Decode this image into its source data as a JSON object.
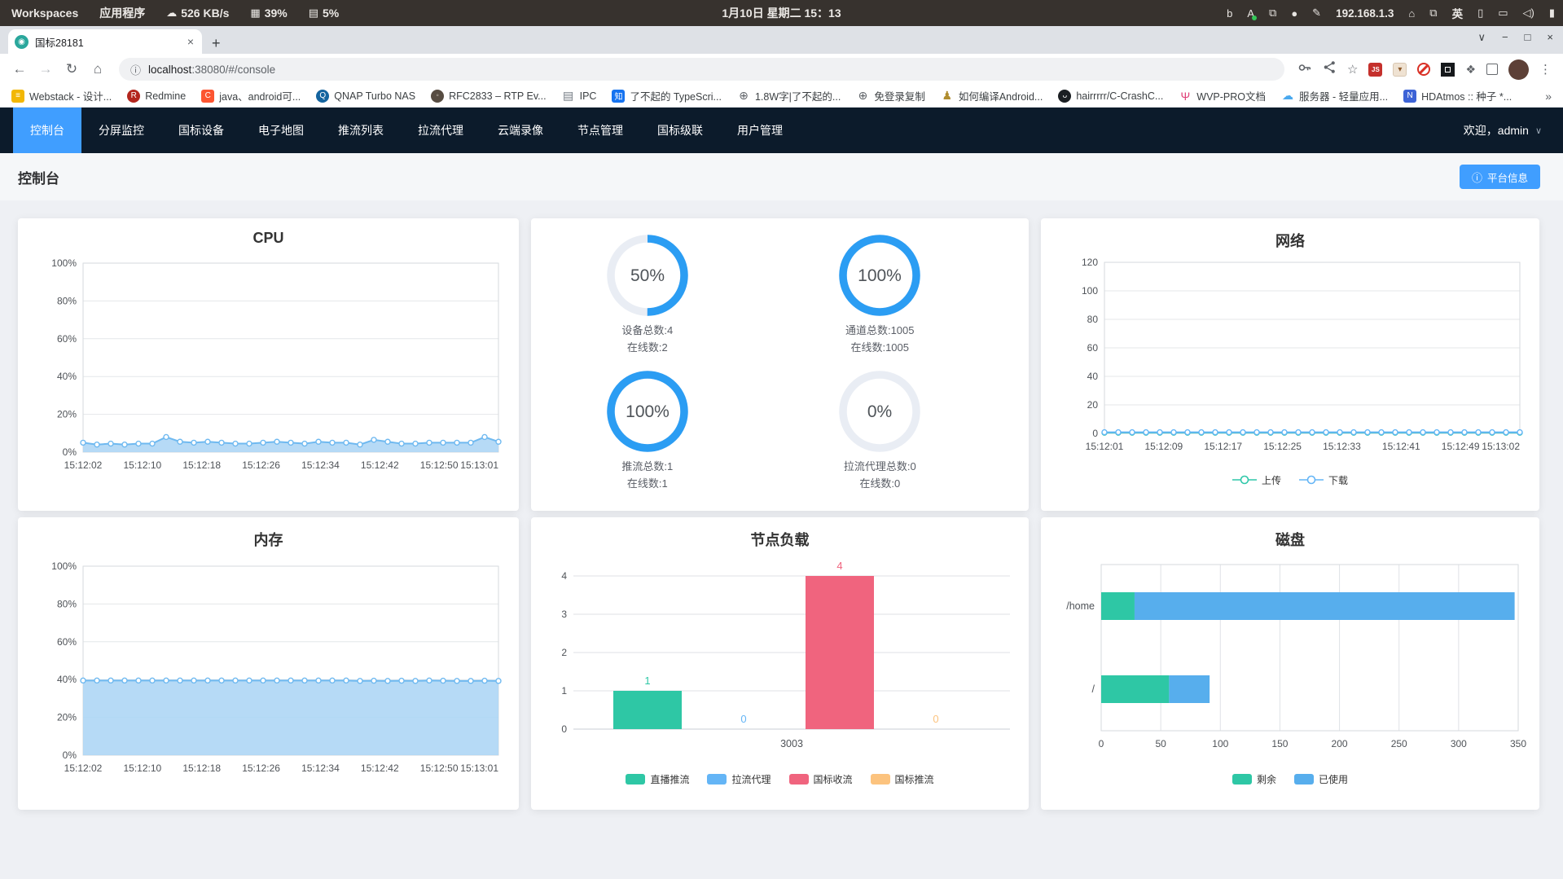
{
  "system_bar": {
    "workspaces": "Workspaces",
    "applications": "应用程序",
    "network_speed": "526 KB/s",
    "cpu_percent": "39%",
    "mem_percent": "5%",
    "datetime": "1月10日 星期二  15：13",
    "tray": [
      {
        "name": "bing-icon",
        "glyph": "b"
      },
      {
        "name": "text-tool-icon",
        "glyph": "A",
        "cls": "atool"
      },
      {
        "name": "clipboard-icon",
        "glyph": "⧉"
      },
      {
        "name": "app-circle-icon",
        "glyph": "●"
      },
      {
        "name": "screenshot-tool-icon",
        "glyph": "✎"
      },
      {
        "name": "ip-address",
        "text": "192.168.1.3"
      },
      {
        "name": "home-icon",
        "glyph": "⌂"
      },
      {
        "name": "windows-overlap-icon",
        "glyph": "⧉"
      },
      {
        "name": "input-method-indicator",
        "text": "英"
      },
      {
        "name": "tablet-icon",
        "glyph": "▯"
      },
      {
        "name": "display-icon",
        "glyph": "▭"
      },
      {
        "name": "volume-icon",
        "glyph": "◁)"
      },
      {
        "name": "battery-icon",
        "glyph": "▮"
      }
    ]
  },
  "browser": {
    "tab_title": "国标28181",
    "url_host": "localhost",
    "url_rest": ":38080/#/console",
    "bookmarks": [
      {
        "label": "Webstack - 设计...",
        "shape": "square",
        "bg": "#f2b705",
        "fg": "#ffffff",
        "glyph": "≡"
      },
      {
        "label": "Redmine",
        "shape": "circle",
        "bg": "#b3261e",
        "fg": "#ffffff",
        "glyph": "R"
      },
      {
        "label": "java、android可...",
        "shape": "square",
        "bg": "#fc5531",
        "fg": "#ffffff",
        "glyph": "C"
      },
      {
        "label": "QNAP Turbo NAS",
        "shape": "circle",
        "bg": "#14649f",
        "fg": "#ffffff",
        "glyph": "Q"
      },
      {
        "label": "RFC2833 – RTP Ev...",
        "shape": "circle",
        "bg": "#574c42",
        "fg": "#cfc8bd",
        "glyph": "◦"
      },
      {
        "label": "IPC",
        "shape": "plain",
        "bg": "",
        "fg": "#707880",
        "glyph": "▤"
      },
      {
        "label": "了不起的 TypeScri...",
        "shape": "square",
        "bg": "#1673f0",
        "fg": "#ffffff",
        "glyph": "知"
      },
      {
        "label": "1.8W字|了不起的...",
        "shape": "plain",
        "bg": "",
        "fg": "#5f6368",
        "glyph": "⊕"
      },
      {
        "label": "免登录复制",
        "shape": "plain",
        "bg": "",
        "fg": "#5f6368",
        "glyph": "⊕"
      },
      {
        "label": "如何编译Android...",
        "shape": "plain",
        "bg": "",
        "fg": "#b08d2f",
        "glyph": "♟"
      },
      {
        "label": "hairrrrr/C-CrashC...",
        "shape": "circle",
        "bg": "#1b1f23",
        "fg": "#ffffff",
        "glyph": "ᴗ"
      },
      {
        "label": "WVP-PRO文档",
        "shape": "plain",
        "bg": "",
        "fg": "#e0447a",
        "glyph": "Ψ"
      },
      {
        "label": "服务器 - 轻量应用...",
        "shape": "plain",
        "bg": "",
        "fg": "#49a8ee",
        "glyph": "☁"
      },
      {
        "label": "HDAtmos :: 种子 *...",
        "shape": "square",
        "bg": "#3d63d6",
        "fg": "#ffffff",
        "glyph": "N"
      }
    ],
    "overflow": "»"
  },
  "icons": {
    "back": "←",
    "forward": "→",
    "reload": "↻",
    "home": "⌂",
    "star": "☆",
    "menu": "⋮",
    "new_tab": "+",
    "tab_close": "×",
    "chevron": "∨",
    "minimize": "−",
    "maximize": "□",
    "close": "×",
    "info": "ⓘ",
    "puzzle": "❖",
    "js_badge": "JS"
  },
  "app": {
    "nav": {
      "items": [
        "控制台",
        "分屏监控",
        "国标设备",
        "电子地图",
        "推流列表",
        "拉流代理",
        "云端录像",
        "节点管理",
        "国标级联",
        "用户管理"
      ],
      "active_index": 0,
      "welcome": "欢迎，admin"
    },
    "page_title": "控制台",
    "platform_info_button": "平台信息",
    "gauges": [
      {
        "percent": "50%",
        "value": 50,
        "line1": "设备总数:4",
        "line2": "在线数:2"
      },
      {
        "percent": "100%",
        "value": 100,
        "line1": "通道总数:1005",
        "line2": "在线数:1005"
      },
      {
        "percent": "100%",
        "value": 100,
        "line1": "推流总数:1",
        "line2": "在线数:1"
      },
      {
        "percent": "0%",
        "value": 0,
        "line1": "拉流代理总数:0",
        "line2": "在线数:0"
      }
    ],
    "gauge_color": "#2b9df3",
    "gauge_track": "#e9edf4"
  },
  "chart_data": [
    {
      "id": "cpu",
      "type": "area",
      "title": "CPU",
      "x_labels": [
        "15:12:02",
        "15:12:10",
        "15:12:18",
        "15:12:26",
        "15:12:34",
        "15:12:42",
        "15:12:50",
        "15:13:01"
      ],
      "ylim": [
        0,
        100
      ],
      "y_tick_step": 20,
      "y_suffix": "%",
      "grid": true,
      "series": [
        {
          "name": "CPU",
          "color": "#6fb9f0",
          "fill": "#a9d4f5",
          "values": [
            5,
            4,
            4.5,
            4,
            4.5,
            4.5,
            8,
            5.5,
            5,
            5.5,
            5,
            4.5,
            4.5,
            5,
            5.5,
            5,
            4.5,
            5.5,
            5,
            5,
            4,
            6.5,
            5.5,
            4.5,
            4.5,
            5,
            5,
            5,
            5,
            8,
            5.5
          ]
        }
      ]
    },
    {
      "id": "network",
      "type": "line",
      "title": "网络",
      "x_labels": [
        "15:12:01",
        "15:12:09",
        "15:12:17",
        "15:12:25",
        "15:12:33",
        "15:12:41",
        "15:12:49",
        "15:13:02"
      ],
      "ylim": [
        0,
        120
      ],
      "y_tick_step": 20,
      "y_suffix": "",
      "grid": true,
      "legend_position": "bottom",
      "legend_style": "line",
      "series": [
        {
          "name": "上传",
          "color": "#2ec7a9",
          "values": [
            0.5,
            0.5,
            0.5,
            0.5,
            0.5,
            0.5,
            0.5,
            0.5,
            0.5,
            0.5,
            0.5,
            0.5,
            0.5,
            0.5,
            0.5,
            0.5,
            0.5,
            0.5,
            0.5,
            0.5,
            0.5,
            0.5,
            0.5,
            0.5,
            0.5,
            0.5,
            0.5,
            0.5,
            0.5,
            0.5,
            0.5
          ]
        },
        {
          "name": "下载",
          "color": "#64b5f6",
          "values": [
            0.8,
            0.8,
            0.8,
            0.8,
            0.8,
            0.8,
            0.8,
            0.8,
            0.8,
            0.8,
            0.8,
            0.8,
            0.8,
            0.8,
            0.8,
            0.8,
            0.8,
            0.8,
            0.8,
            0.8,
            0.8,
            0.8,
            0.8,
            0.8,
            0.8,
            0.8,
            0.8,
            0.8,
            0.8,
            0.8,
            0.8
          ]
        }
      ]
    },
    {
      "id": "memory",
      "type": "area",
      "title": "内存",
      "x_labels": [
        "15:12:02",
        "15:12:10",
        "15:12:18",
        "15:12:26",
        "15:12:34",
        "15:12:42",
        "15:12:50",
        "15:13:01"
      ],
      "ylim": [
        0,
        100
      ],
      "y_tick_step": 20,
      "y_suffix": "%",
      "grid": true,
      "series": [
        {
          "name": "内存",
          "color": "#6fb9f0",
          "fill": "#a9d4f5",
          "values": [
            39.5,
            39.5,
            39.5,
            39.5,
            39.5,
            39.5,
            39.5,
            39.5,
            39.5,
            39.5,
            39.5,
            39.5,
            39.5,
            39.5,
            39.5,
            39.5,
            39.5,
            39.5,
            39.5,
            39.5,
            39.3,
            39.4,
            39.3,
            39.4,
            39.3,
            39.5,
            39.4,
            39.3,
            39.3,
            39.4,
            39.3
          ]
        }
      ]
    },
    {
      "id": "load",
      "type": "bar",
      "title": "节点负载",
      "categories": [
        "3003"
      ],
      "ylim": [
        0,
        4
      ],
      "y_tick_step": 1,
      "grid": true,
      "legend_position": "bottom",
      "legend_style": "chip",
      "series": [
        {
          "name": "直播推流",
          "color": "#2ec7a5",
          "values": [
            1
          ]
        },
        {
          "name": "拉流代理",
          "color": "#64b5f6",
          "values": [
            0
          ]
        },
        {
          "name": "国标收流",
          "color": "#f0647e",
          "values": [
            4
          ]
        },
        {
          "name": "国标推流",
          "color": "#fcc37e",
          "values": [
            0
          ]
        }
      ]
    },
    {
      "id": "disk",
      "type": "hbar-stacked",
      "title": "磁盘",
      "categories": [
        "/home",
        "/"
      ],
      "xlim": [
        0,
        350
      ],
      "x_tick_step": 50,
      "grid": true,
      "legend_position": "bottom",
      "legend_style": "chip",
      "series": [
        {
          "name": "剩余",
          "color": "#2ec7a5",
          "values": [
            28,
            57
          ]
        },
        {
          "name": "已使用",
          "color": "#57aeed",
          "values": [
            319,
            34
          ]
        }
      ]
    }
  ]
}
